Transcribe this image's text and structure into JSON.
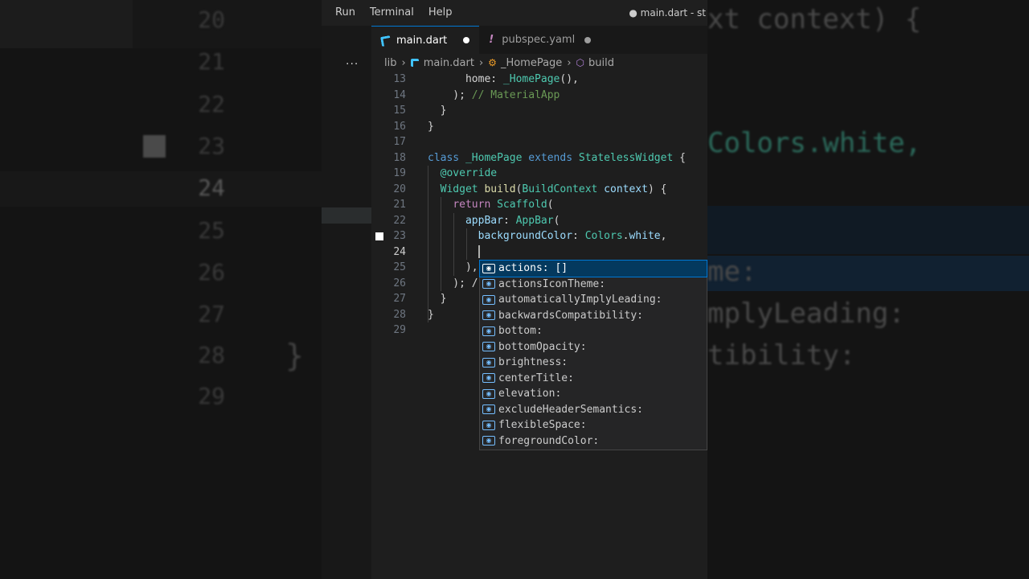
{
  "menu": [
    "Run",
    "Terminal",
    "Help"
  ],
  "window_title": "● main.dart - st",
  "tabs": [
    {
      "label": "main.dart",
      "dirty": true
    },
    {
      "label": "pubspec.yaml",
      "dirty": true
    }
  ],
  "breadcrumb": {
    "folder": "lib",
    "file": "main.dart",
    "class": "_HomePage",
    "method": "build"
  },
  "code_lines": [
    {
      "num": "13",
      "html": "      home: <span class='a'>_HomePage</span>(),"
    },
    {
      "num": "14",
      "html": "    ); <span class='c'>// MaterialApp</span>"
    },
    {
      "num": "15",
      "html": "  }"
    },
    {
      "num": "16",
      "html": "}"
    },
    {
      "num": "17",
      "html": ""
    },
    {
      "num": "18",
      "html": "<span class='k'>class</span> <span class='t'>_HomePage</span> <span class='k'>extends</span> <span class='t'>StatelessWidget</span> {"
    },
    {
      "num": "19",
      "html": "  <span class='t'>@override</span>"
    },
    {
      "num": "20",
      "html": "  <span class='t'>Widget</span> <span class='f'>build</span>(<span class='t'>BuildContext</span> <span class='v'>context</span>) {"
    },
    {
      "num": "21",
      "html": "    <span class='kc'>return</span> <span class='t'>Scaffold</span>("
    },
    {
      "num": "22",
      "html": "      <span class='v'>appBar</span>: <span class='t'>AppBar</span>("
    },
    {
      "num": "23",
      "html": "        <span class='v'>backgroundColor</span>: <span class='t'>Colors</span>.<span class='v'>white</span>,"
    },
    {
      "num": "24",
      "html": "        <span class='cursor'></span>"
    },
    {
      "num": "25",
      "html": "      ), /"
    },
    {
      "num": "26",
      "html": "    ); /"
    },
    {
      "num": "27",
      "html": "  }"
    },
    {
      "num": "28",
      "html": "}"
    },
    {
      "num": "29",
      "html": ""
    }
  ],
  "suggestions": [
    "actions: []",
    "actionsIconTheme:",
    "automaticallyImplyLeading:",
    "backwardsCompatibility:",
    "bottom:",
    "bottomOpacity:",
    "brightness:",
    "centerTitle:",
    "elevation:",
    "excludeHeaderSemantics:",
    "flexibleSpace:",
    "foregroundColor:"
  ],
  "suggestion_icon": "[⊚]",
  "bg_left_numbers": [
    "20",
    "21",
    "22",
    "23",
    "24",
    "25",
    "26",
    "27",
    "28",
    "29"
  ],
  "bg_left_brace": "}",
  "bg_right_lines": [
    "xt context) {",
    "Colors.white,",
    "me:",
    "mplyLeading:",
    "tibility:"
  ],
  "colors": {
    "accent": "#0078d4",
    "selection": "#04395e",
    "editor_bg": "#1e1e1e"
  }
}
